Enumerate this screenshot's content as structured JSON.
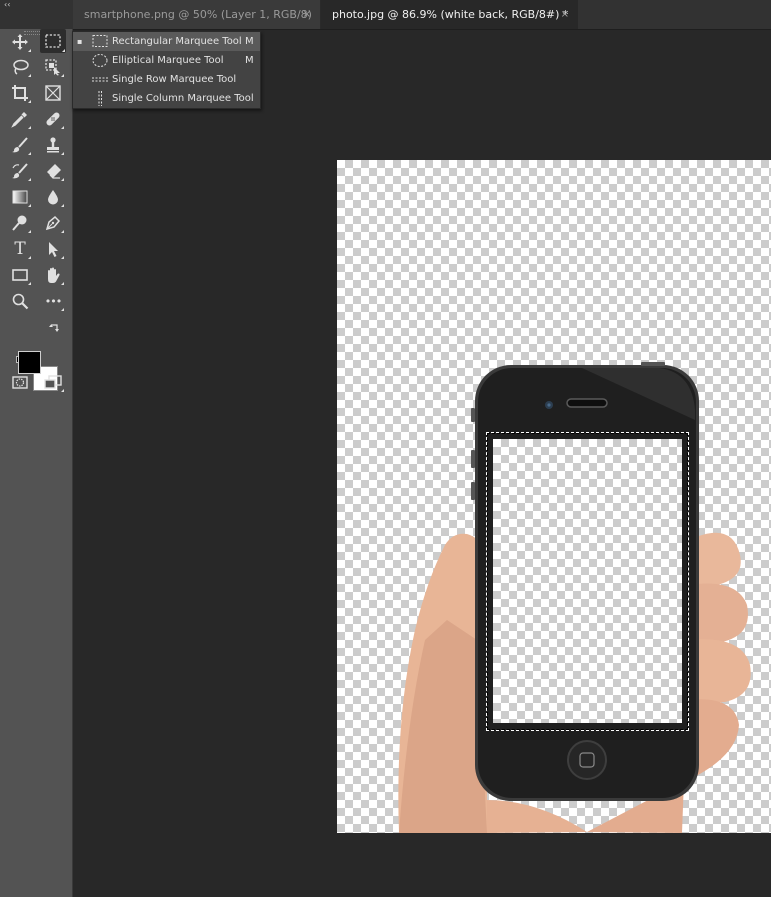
{
  "tabs": [
    {
      "title": "smartphone.png @ 50% (Layer 1, RGB/8)",
      "close": "×",
      "active": false
    },
    {
      "title": "photo.jpg @ 86.9% (white back, RGB/8#) *",
      "close": "×",
      "active": true
    }
  ],
  "toolbar": {
    "collapse": "‹‹",
    "tools": [
      {
        "name": "move-tool",
        "icon": "move-icon"
      },
      {
        "name": "rectangular-marquee-tool",
        "icon": "marquee-icon",
        "active": true
      },
      {
        "name": "lasso-tool",
        "icon": "lasso-icon"
      },
      {
        "name": "object-selection-tool",
        "icon": "object-selection-icon"
      },
      {
        "name": "crop-tool",
        "icon": "crop-icon"
      },
      {
        "name": "frame-tool",
        "icon": "frame-icon"
      },
      {
        "name": "eyedropper-tool",
        "icon": "eyedropper-icon"
      },
      {
        "name": "healing-brush-tool",
        "icon": "bandage-icon"
      },
      {
        "name": "brush-tool",
        "icon": "brush-icon"
      },
      {
        "name": "clone-stamp-tool",
        "icon": "stamp-icon"
      },
      {
        "name": "history-brush-tool",
        "icon": "history-brush-icon"
      },
      {
        "name": "eraser-tool",
        "icon": "eraser-icon"
      },
      {
        "name": "gradient-tool",
        "icon": "gradient-icon"
      },
      {
        "name": "blur-tool",
        "icon": "drop-icon"
      },
      {
        "name": "dodge-tool",
        "icon": "dodge-icon"
      },
      {
        "name": "pen-tool",
        "icon": "pen-icon"
      },
      {
        "name": "type-tool",
        "icon": "type-icon",
        "label": "T"
      },
      {
        "name": "path-selection-tool",
        "icon": "arrow-icon"
      },
      {
        "name": "rectangle-tool",
        "icon": "rectangle-icon"
      },
      {
        "name": "hand-tool",
        "icon": "hand-icon"
      },
      {
        "name": "zoom-tool",
        "icon": "zoom-icon"
      },
      {
        "name": "edit-toolbar",
        "icon": "more-icon",
        "label": "•••"
      }
    ],
    "foreground_color": "#000000",
    "background_color": "#ffffff"
  },
  "flyout": {
    "items": [
      {
        "label": "Rectangular Marquee Tool",
        "shortcut": "M",
        "icon": "rect-marquee-icon",
        "selected": true,
        "marker": "▪"
      },
      {
        "label": "Elliptical Marquee Tool",
        "shortcut": "M",
        "icon": "ellipse-marquee-icon",
        "selected": false
      },
      {
        "label": "Single Row Marquee Tool",
        "shortcut": "",
        "icon": "row-marquee-icon",
        "selected": false
      },
      {
        "label": "Single Column Marquee Tool",
        "shortcut": "",
        "icon": "column-marquee-icon",
        "selected": false
      }
    ]
  },
  "colors": {
    "app_bg": "#282828",
    "toolbar_bg": "#535353",
    "flyout_bg": "#434343",
    "flyout_selected": "#5a5a5a",
    "phone_body": "#1f1f1f",
    "skin": "#e9b79a"
  }
}
